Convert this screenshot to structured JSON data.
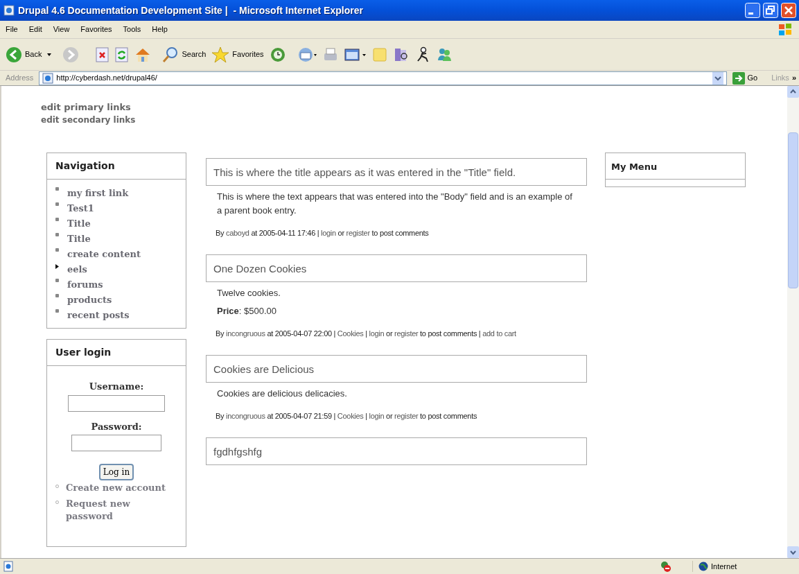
{
  "window": {
    "title": "Drupal 4.6 Documentation Development Site |  - Microsoft Internet Explorer"
  },
  "menu": [
    "File",
    "Edit",
    "View",
    "Favorites",
    "Tools",
    "Help"
  ],
  "toolbar": {
    "back": "Back",
    "search": "Search",
    "favorites": "Favorites"
  },
  "address": {
    "label": "Address",
    "value": "http://cyberdash.net/drupal46/",
    "go": "Go",
    "links": "Links",
    "more": "»"
  },
  "admin_links": [
    "edit primary links",
    "edit secondary links"
  ],
  "navigation": {
    "title": "Navigation",
    "items": [
      {
        "label": "my first link",
        "kind": "leaf"
      },
      {
        "label": "Test1",
        "kind": "leaf"
      },
      {
        "label": "Title",
        "kind": "leaf"
      },
      {
        "label": "Title",
        "kind": "leaf"
      },
      {
        "label": "create content",
        "kind": "leaf"
      },
      {
        "label": "eels",
        "kind": "collapsed"
      },
      {
        "label": "forums",
        "kind": "leaf"
      },
      {
        "label": "products",
        "kind": "leaf"
      },
      {
        "label": "recent posts",
        "kind": "leaf"
      }
    ]
  },
  "user_login": {
    "title": "User login",
    "username_label": "Username:",
    "password_label": "Password:",
    "button": "Log in",
    "links": [
      "Create new account",
      "Request new password"
    ]
  },
  "posts": [
    {
      "title": "This is where the title appears as it was entered in the \"Title\" field.",
      "body": [
        "This is where the text appears that was entered into the \"Body\" field and is an example of a parent book entry."
      ],
      "meta": [
        {
          "text": "By ",
          "kind": "plain"
        },
        {
          "text": "caboyd",
          "kind": "link"
        },
        {
          "text": " at 2005-04-11 17:46 | ",
          "kind": "plain"
        },
        {
          "text": "login",
          "kind": "link"
        },
        {
          "text": " or ",
          "kind": "plain"
        },
        {
          "text": "register",
          "kind": "link"
        },
        {
          "text": " to post comments",
          "kind": "plain"
        }
      ]
    },
    {
      "title": "One Dozen Cookies",
      "body": [
        "Twelve cookies.",
        "**Price**: $500.00"
      ],
      "meta": [
        {
          "text": "By ",
          "kind": "plain"
        },
        {
          "text": "incongruous",
          "kind": "link"
        },
        {
          "text": " at 2005-04-07 22:00 | ",
          "kind": "plain"
        },
        {
          "text": "Cookies",
          "kind": "link"
        },
        {
          "text": " | ",
          "kind": "plain"
        },
        {
          "text": "login",
          "kind": "link"
        },
        {
          "text": " or ",
          "kind": "plain"
        },
        {
          "text": "register",
          "kind": "link"
        },
        {
          "text": " to post comments | ",
          "kind": "plain"
        },
        {
          "text": "add to cart",
          "kind": "link"
        }
      ]
    },
    {
      "title": "Cookies are Delicious",
      "body": [
        "Cookies are delicious delicacies."
      ],
      "meta": [
        {
          "text": "By ",
          "kind": "plain"
        },
        {
          "text": "incongruous",
          "kind": "link"
        },
        {
          "text": " at 2005-04-07 21:59 | ",
          "kind": "plain"
        },
        {
          "text": "Cookies",
          "kind": "link"
        },
        {
          "text": " | ",
          "kind": "plain"
        },
        {
          "text": "login",
          "kind": "link"
        },
        {
          "text": " or ",
          "kind": "plain"
        },
        {
          "text": "register",
          "kind": "link"
        },
        {
          "text": " to post comments",
          "kind": "plain"
        }
      ]
    },
    {
      "title": "fgdhfgshfg"
    }
  ],
  "my_menu": {
    "title": "My Menu"
  },
  "status_bar": {
    "zone": "Internet"
  }
}
